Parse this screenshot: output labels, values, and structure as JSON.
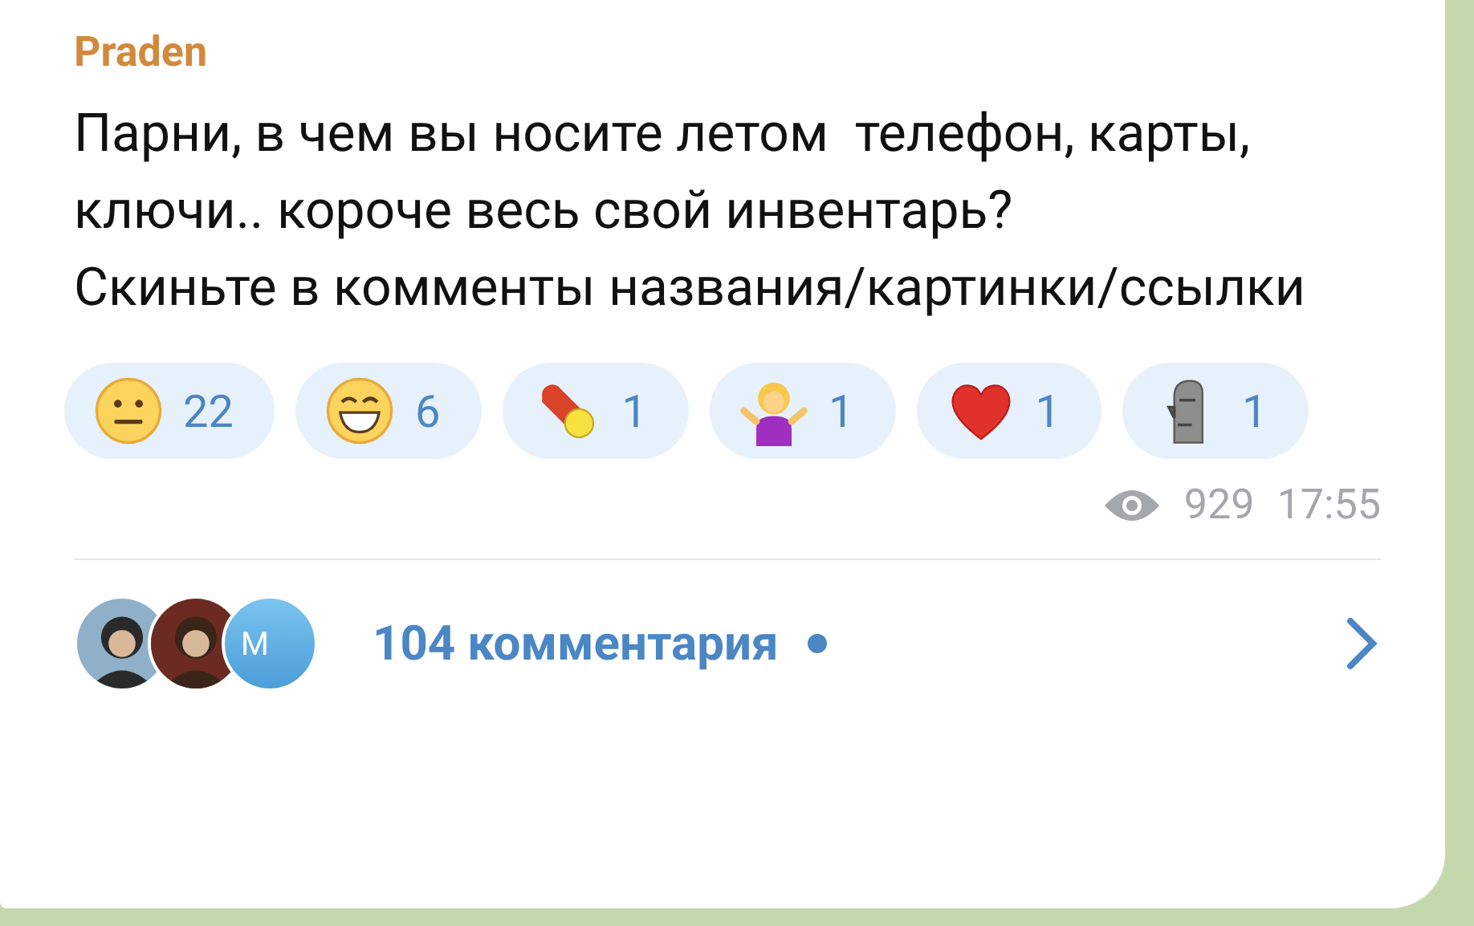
{
  "message": {
    "author": "Praden",
    "text": "Парни, в чем вы носите летом  телефон, карты, ключи.. короче весь свой инвентарь?\nСкиньте в комменты названия/картинки/ссылки",
    "reactions": [
      {
        "kind": "neutral",
        "count": "22"
      },
      {
        "kind": "grin",
        "count": "6"
      },
      {
        "kind": "pill",
        "count": "1"
      },
      {
        "kind": "shrug",
        "count": "1"
      },
      {
        "kind": "heart",
        "count": "1"
      },
      {
        "kind": "moai",
        "count": "1"
      }
    ],
    "views": "929",
    "time": "17:55"
  },
  "comments": {
    "avatars": [
      {
        "kind": "picture"
      },
      {
        "kind": "picture"
      },
      {
        "kind": "letter",
        "letter": "M"
      }
    ],
    "label": "104 комментария",
    "unread": true
  }
}
